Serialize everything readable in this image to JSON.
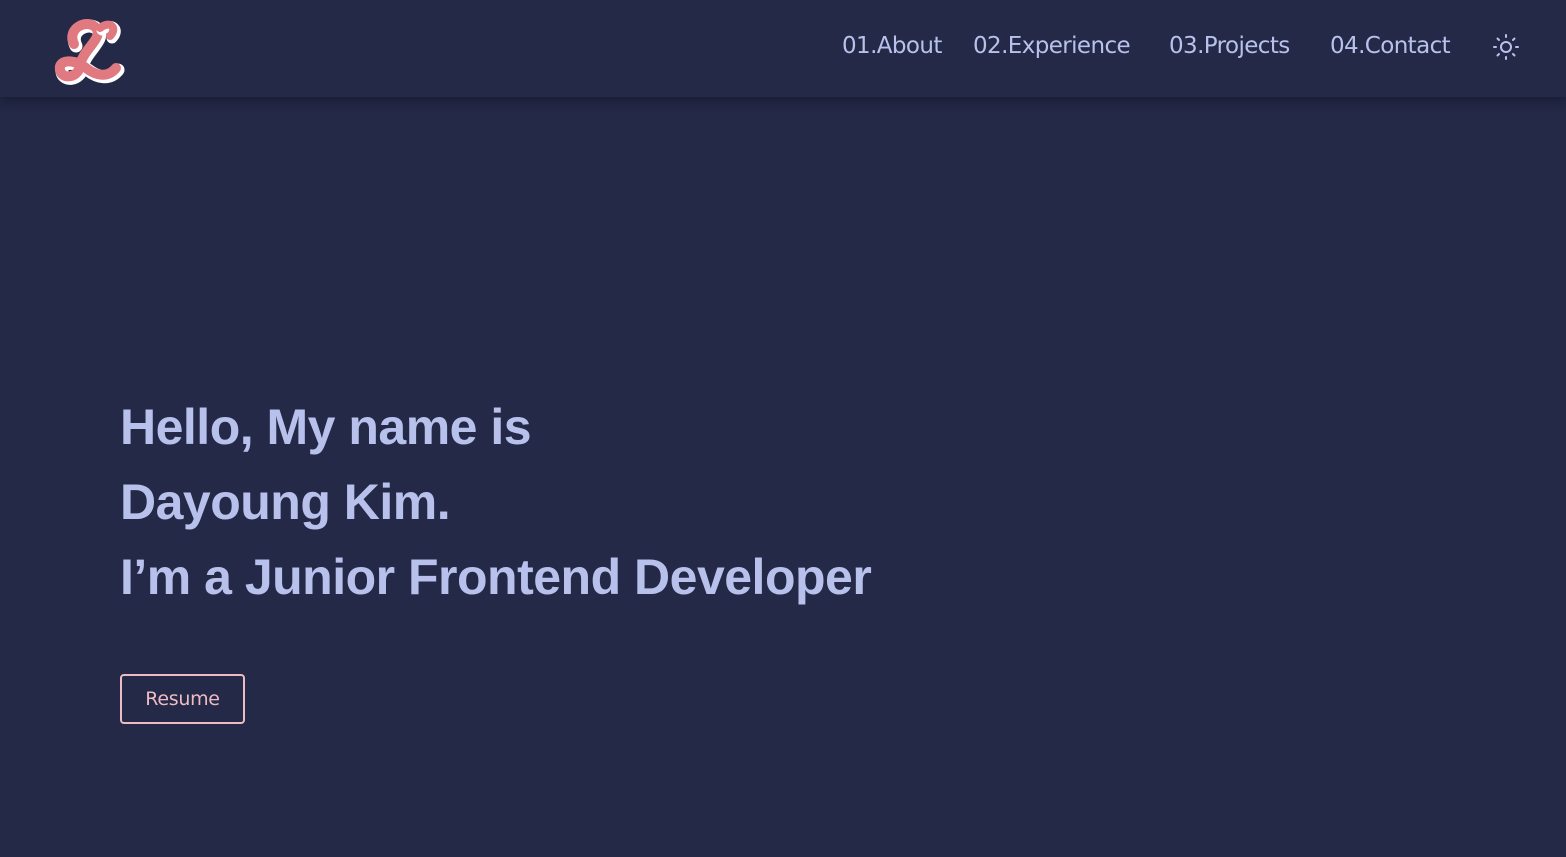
{
  "header": {
    "logo_icon": "cursive-letter-l-logo",
    "nav": [
      {
        "label": "01.About"
      },
      {
        "label": "02.Experience"
      },
      {
        "label": "03.Projects"
      },
      {
        "label": "04.Contact"
      }
    ],
    "theme_toggle_icon": "sun-icon"
  },
  "hero": {
    "line1": "Hello, My name is",
    "line2": "Dayoung Kim.",
    "line3": "I’m a Junior Frontend Developer",
    "resume_label": "Resume"
  },
  "colors": {
    "background": "#232946",
    "text": "#b8c1ec",
    "accent": "#eebbc3",
    "logo": "#e07a80"
  }
}
